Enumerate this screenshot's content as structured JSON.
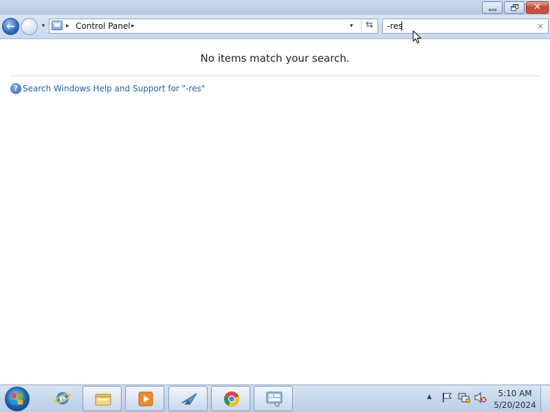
{
  "window": {
    "title": "",
    "minimize_label": "",
    "maximize_label": "",
    "close_label": "✕"
  },
  "navigation": {
    "back_glyph": "←",
    "forward_glyph": "→",
    "recent_glyph": "▾",
    "breadcrumb": [
      "Control Panel"
    ],
    "separator_glyph": "▸",
    "address_dropdown_glyph": "▾",
    "refresh_glyph": "⇆"
  },
  "search": {
    "value": "-res",
    "clear_glyph": "×"
  },
  "content": {
    "no_items_message": "No items match your search.",
    "help_link_text": "Search Windows Help and Support for \"-res\"",
    "help_icon_glyph": "?"
  },
  "taskbar": {
    "items": [
      "internet-explorer",
      "windows-explorer",
      "windows-media-player",
      "paint",
      "google-chrome",
      "control-panel"
    ],
    "tray_arrow_glyph": "▲",
    "clock_time": "5:10 AM",
    "clock_date": "5/20/2024"
  },
  "colors": {
    "link": "#1d5fb4",
    "close_button": "#c64532",
    "taskbar": "#b9cde5"
  }
}
